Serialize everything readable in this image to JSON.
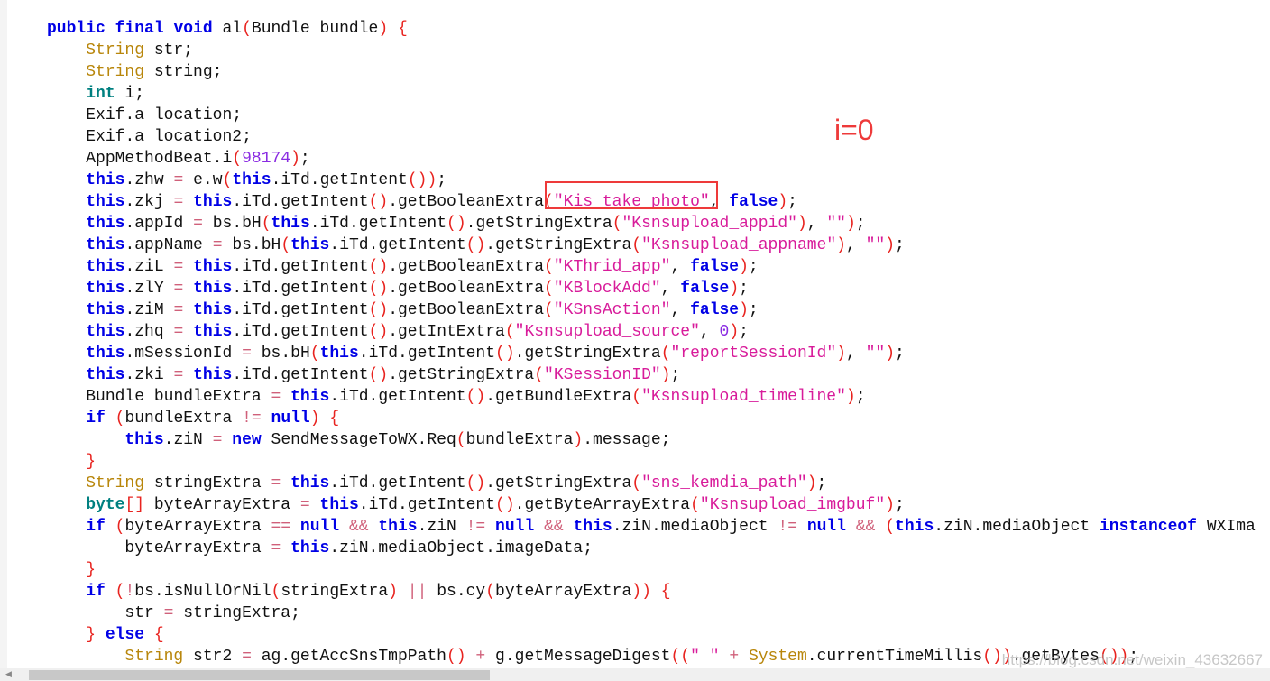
{
  "code_lines": [
    "public final void al(Bundle bundle) {",
    "    String str;",
    "    String string;",
    "    int i;",
    "    Exif.a location;",
    "    Exif.a location2;",
    "    AppMethodBeat.i(98174);",
    "    this.zhw = e.w(this.iTd.getIntent());",
    "    this.zkj = this.iTd.getIntent().getBooleanExtra(\"Kis_take_photo\", false);",
    "    this.appId = bs.bH(this.iTd.getIntent().getStringExtra(\"Ksnsupload_appid\"), \"\");",
    "    this.appName = bs.bH(this.iTd.getIntent().getStringExtra(\"Ksnsupload_appname\"), \"\");",
    "    this.ziL = this.iTd.getIntent().getBooleanExtra(\"KThrid_app\", false);",
    "    this.zlY = this.iTd.getIntent().getBooleanExtra(\"KBlockAdd\", false);",
    "    this.ziM = this.iTd.getIntent().getBooleanExtra(\"KSnsAction\", false);",
    "    this.zhq = this.iTd.getIntent().getIntExtra(\"Ksnsupload_source\", 0);",
    "    this.mSessionId = bs.bH(this.iTd.getIntent().getStringExtra(\"reportSessionId\"), \"\");",
    "    this.zki = this.iTd.getIntent().getStringExtra(\"KSessionID\");",
    "    Bundle bundleExtra = this.iTd.getIntent().getBundleExtra(\"Ksnsupload_timeline\");",
    "    if (bundleExtra != null) {",
    "        this.ziN = new SendMessageToWX.Req(bundleExtra).message;",
    "    }",
    "    String stringExtra = this.iTd.getIntent().getStringExtra(\"sns_kemdia_path\");",
    "    byte[] byteArrayExtra = this.iTd.getIntent().getByteArrayExtra(\"Ksnsupload_imgbuf\");",
    "    if (byteArrayExtra == null && this.ziN != null && this.ziN.mediaObject != null && (this.ziN.mediaObject instanceof WXIma",
    "        byteArrayExtra = this.ziN.mediaObject.imageData;",
    "    }",
    "    if (!bs.isNullOrNil(stringExtra) || bs.cy(byteArrayExtra)) {",
    "        str = stringExtra;",
    "    } else {",
    "        String str2 = ag.getAccSnsTmpPath() + g.getMessageDigest((\" \" + System.currentTimeMillis()).getBytes());"
  ],
  "annotation": {
    "text": "i=0",
    "color": "#ee3a3a"
  },
  "highlight_box_target": "(\"Kis_take_photo\"",
  "watermark": "https://blog.csdn.net/weixin_43632667",
  "colors": {
    "keyword": "#0000e6",
    "type": "#b8860b",
    "primitive": "#008080",
    "string": "#d81b9a",
    "number": "#8a2be2",
    "bracket": "#e8231f"
  }
}
